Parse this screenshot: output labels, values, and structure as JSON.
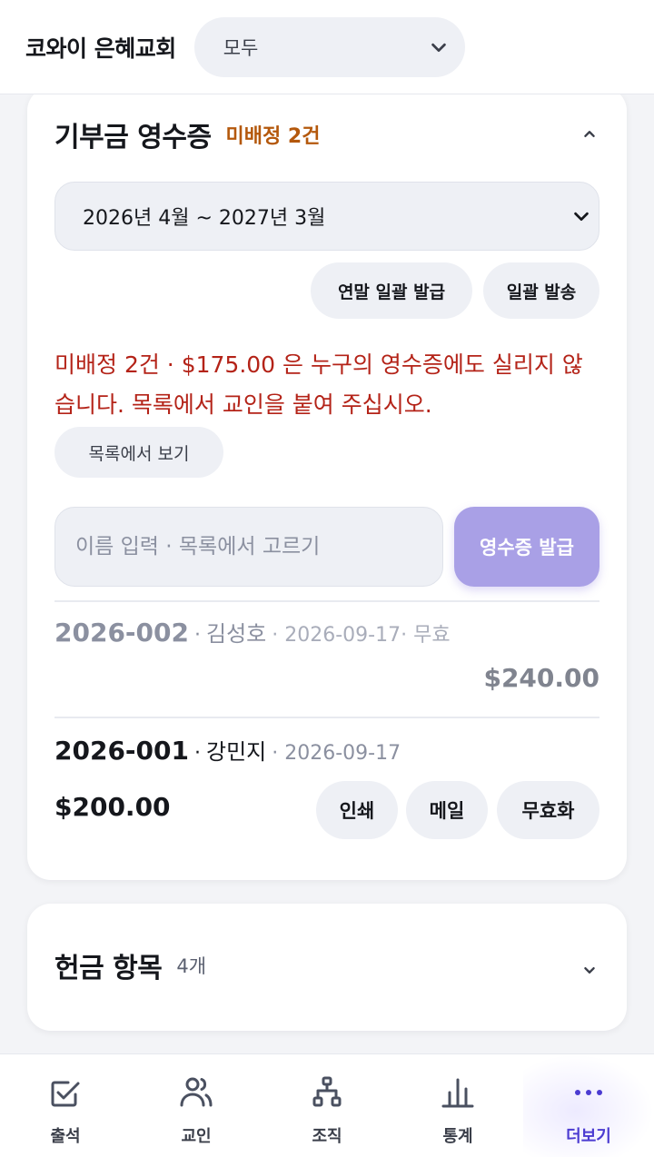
{
  "header": {
    "church_name": "코와이 은혜교회",
    "scope_selected": "모두"
  },
  "receipts": {
    "title": "기부금 영수증",
    "badge": "미배정 2건",
    "period_selected": "2026년 4월 ~ 2027년 3월",
    "year_end_batch_label": "연말 일괄 발급",
    "batch_send_label": "일괄 발송",
    "warning_text": "미배정 2건 · $175.00 은 누구의 영수증에도 실리지 않습니다. 목록에서 교인을 붙여 주십시오.",
    "view_list_label": "목록에서 보기",
    "name_placeholder": "이름 입력 · 목록에서 고르기",
    "issue_label": "영수증 발급",
    "items": [
      {
        "number": "2026-002",
        "sep": "·",
        "name": "김성호",
        "date_status": "· 2026-09-17· 무효",
        "amount": "$240.00"
      },
      {
        "number": "2026-001",
        "sep": "·",
        "name": "강민지",
        "date_status": "· 2026-09-17",
        "amount": "$200.00",
        "actions": {
          "print": "인쇄",
          "email": "메일",
          "void": "무효화"
        }
      }
    ]
  },
  "cash": {
    "title": "헌금 항목",
    "count": "4개"
  },
  "tabs": [
    {
      "label": "출석",
      "icon": "check-square-icon"
    },
    {
      "label": "교인",
      "icon": "people-icon"
    },
    {
      "label": "조직",
      "icon": "org-chart-icon"
    },
    {
      "label": "통계",
      "icon": "bar-chart-icon"
    },
    {
      "label": "더보기",
      "icon": "more-dots-icon",
      "active": true
    }
  ],
  "colors": {
    "accent": "#4b3bd1",
    "warning": "#b42318",
    "badge": "#b4580c",
    "issue_button": "#a9a0e6"
  }
}
